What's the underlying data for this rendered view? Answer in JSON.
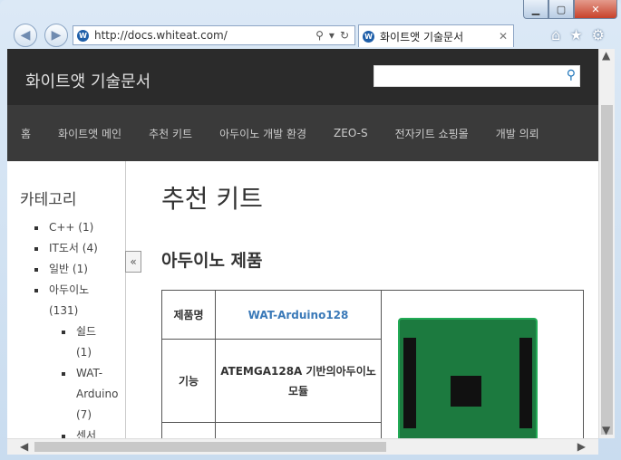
{
  "browser": {
    "url": "http://docs.whiteat.com/",
    "tab_title": "화이트앳 기술문서",
    "window_buttons": {
      "minimize": "▁",
      "maximize": "▢",
      "close": "✕"
    },
    "icons": [
      "back-icon",
      "forward-icon",
      "search-icon",
      "dropdown-icon",
      "refresh-icon",
      "home-icon",
      "star-icon",
      "gear-icon"
    ]
  },
  "site": {
    "title": "화이트앳 기술문서",
    "nav": [
      "홈",
      "화이트앳 메인",
      "추천 키트",
      "아두이노 개발 환경",
      "ZEO-S",
      "전자키트 쇼핑몰",
      "개발 의뢰"
    ]
  },
  "sidebar": {
    "heading": "카테고리",
    "items": [
      {
        "label": "C++ (1)"
      },
      {
        "label": "IT도서 (4)"
      },
      {
        "label": "일반 (1)"
      },
      {
        "label": "아두이노 (131)"
      }
    ],
    "subitems": [
      {
        "label": "쉴드 (1)"
      },
      {
        "label": "WAT-Arduino (7)"
      },
      {
        "label": "센서"
      }
    ]
  },
  "content": {
    "page_title": "추천 키트",
    "section_title": "아두이노 제품",
    "table": {
      "rows": [
        {
          "header": "제품명",
          "value": "WAT-Arduino128"
        },
        {
          "header": "기능",
          "value": "ATEMGA128A 기반의아두이노 모듈"
        }
      ]
    }
  },
  "colors": {
    "header_bg": "#2b2b2b",
    "nav_bg": "#3a3a3a",
    "link": "#3a79b8"
  }
}
